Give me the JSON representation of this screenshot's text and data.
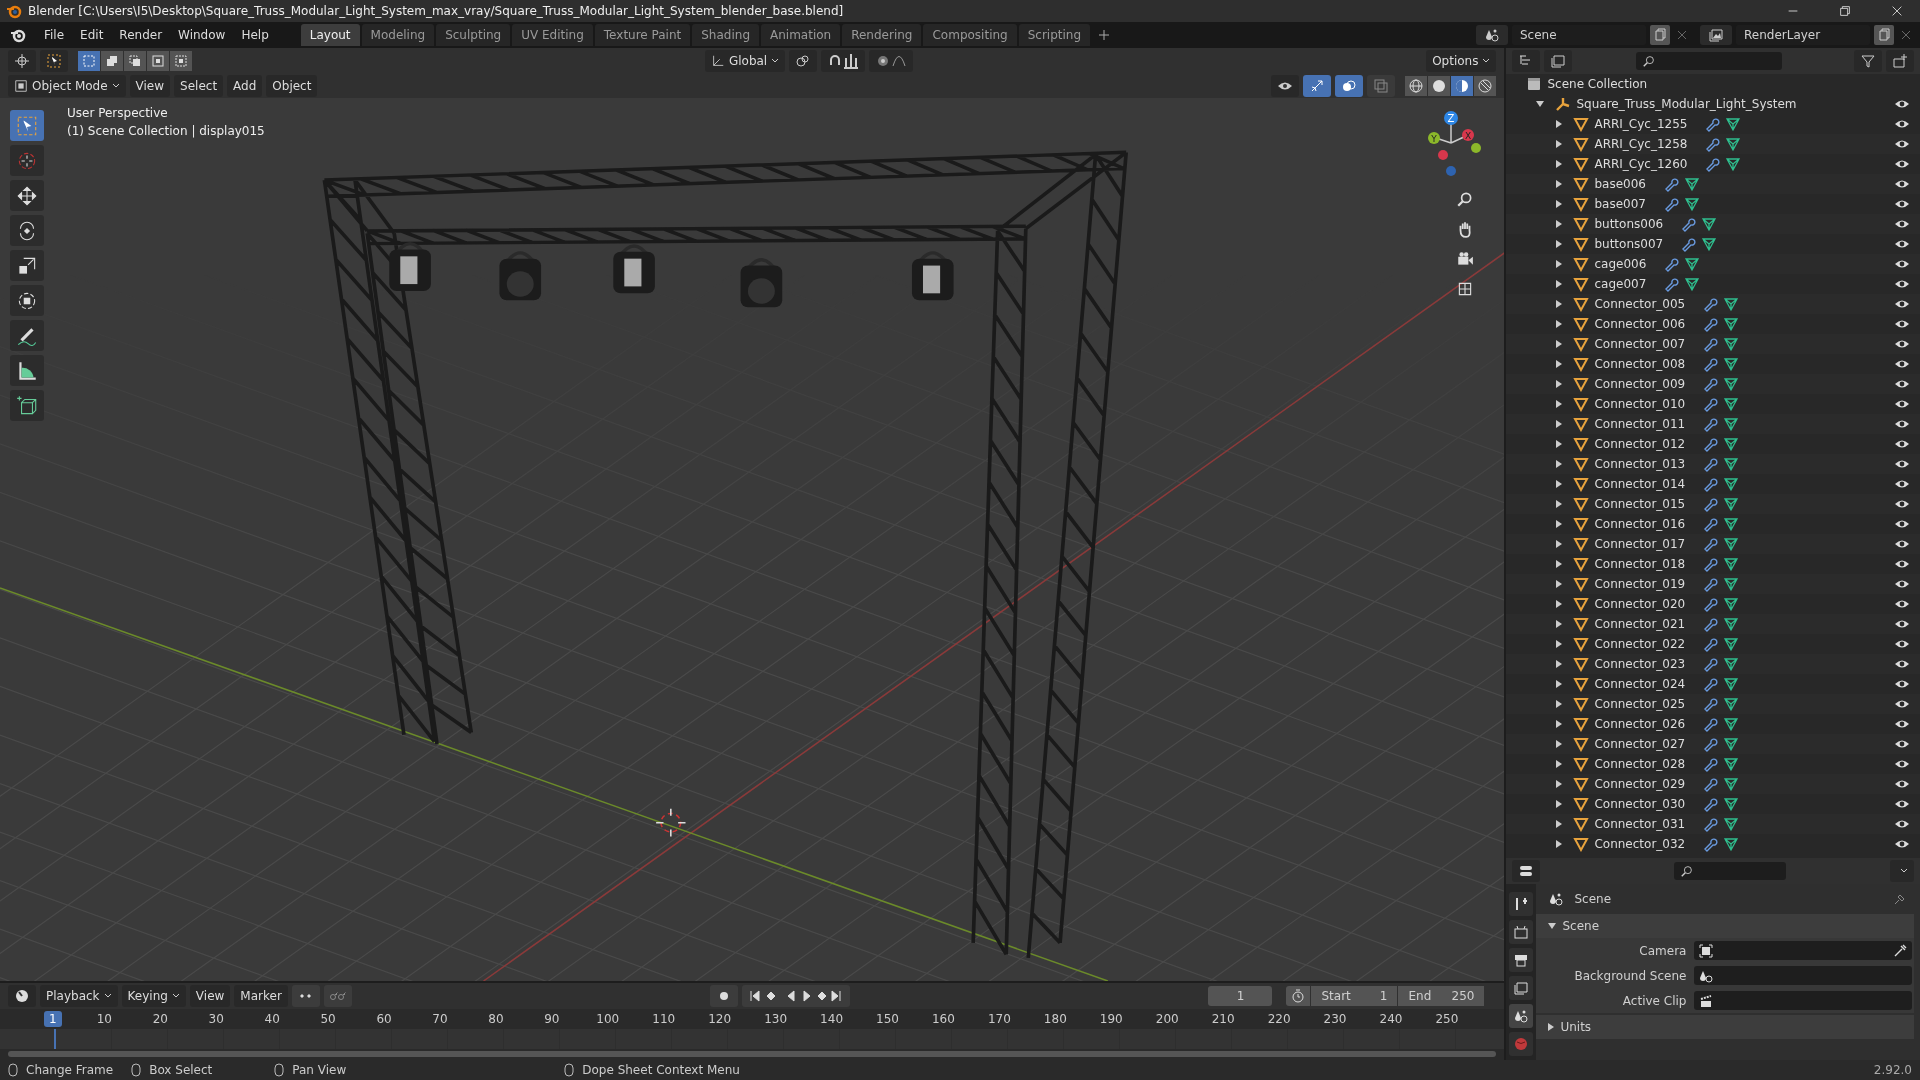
{
  "title_bar": {
    "title": "Blender [C:\\Users\\I5\\Desktop\\Square_Truss_Modular_Light_System_max_vray/Square_Truss_Modular_Light_System_blender_base.blend]"
  },
  "menu": [
    "File",
    "Edit",
    "Render",
    "Window",
    "Help"
  ],
  "workspace_tabs": [
    {
      "label": "Layout",
      "selected": true
    },
    {
      "label": "Modeling",
      "selected": false
    },
    {
      "label": "Sculpting",
      "selected": false
    },
    {
      "label": "UV Editing",
      "selected": false
    },
    {
      "label": "Texture Paint",
      "selected": false
    },
    {
      "label": "Shading",
      "selected": false
    },
    {
      "label": "Animation",
      "selected": false
    },
    {
      "label": "Rendering",
      "selected": false
    },
    {
      "label": "Compositing",
      "selected": false
    },
    {
      "label": "Scripting",
      "selected": false
    }
  ],
  "scene_selector": {
    "scene": "Scene",
    "view_layer": "RenderLayer"
  },
  "viewport": {
    "select_modes": [
      {
        "kind": "new",
        "selected": true
      },
      {
        "kind": "extend",
        "selected": false
      },
      {
        "kind": "subtract",
        "selected": false
      },
      {
        "kind": "invert",
        "selected": false
      },
      {
        "kind": "intersect",
        "selected": false
      }
    ],
    "orientation": "Global",
    "options": "Options",
    "mode": "Object Mode",
    "menus": [
      "View",
      "Select",
      "Add",
      "Object"
    ],
    "overlay_toggles": [
      {
        "kind": "gizmo",
        "on": true
      },
      {
        "kind": "overlay",
        "on": true
      },
      {
        "kind": "xray",
        "on": false
      }
    ],
    "shading_modes": [
      {
        "kind": "wireframe",
        "selected": false
      },
      {
        "kind": "solid",
        "selected": false
      },
      {
        "kind": "material",
        "selected": true
      },
      {
        "kind": "rendered",
        "selected": false
      }
    ],
    "view_name": "User Perspective",
    "context": "(1) Scene Collection | display015",
    "tools": [
      {
        "kind": "select",
        "selected": true
      },
      {
        "kind": "cursor",
        "selected": false
      },
      {
        "kind": "move",
        "selected": false
      },
      {
        "kind": "rotate",
        "selected": false
      },
      {
        "kind": "scale",
        "selected": false
      },
      {
        "kind": "transform",
        "selected": false
      },
      {
        "kind": "annotate",
        "selected": false
      },
      {
        "kind": "measure",
        "selected": false
      },
      {
        "kind": "add-cube",
        "selected": false
      }
    ],
    "gizmo_axes": [
      "Z",
      "Y",
      "X"
    ]
  },
  "outliner": {
    "root": "Scene Collection",
    "collection": {
      "name": "Square_Truss_Modular_Light_System",
      "expanded": true,
      "children": [
        {
          "name": "ARRI_Cyc_1255",
          "expanded": false
        },
        {
          "name": "ARRI_Cyc_1258",
          "expanded": false
        },
        {
          "name": "ARRI_Cyc_1260",
          "expanded": false
        },
        {
          "name": "base006",
          "expanded": false
        },
        {
          "name": "base007",
          "expanded": false
        },
        {
          "name": "buttons006",
          "expanded": false
        },
        {
          "name": "buttons007",
          "expanded": false
        },
        {
          "name": "cage006",
          "expanded": false
        },
        {
          "name": "cage007",
          "expanded": false
        },
        {
          "name": "Connector_005",
          "expanded": false
        },
        {
          "name": "Connector_006",
          "expanded": false
        },
        {
          "name": "Connector_007",
          "expanded": false
        },
        {
          "name": "Connector_008",
          "expanded": false
        },
        {
          "name": "Connector_009",
          "expanded": false
        },
        {
          "name": "Connector_010",
          "expanded": false
        },
        {
          "name": "Connector_011",
          "expanded": false
        },
        {
          "name": "Connector_012",
          "expanded": false
        },
        {
          "name": "Connector_013",
          "expanded": false
        },
        {
          "name": "Connector_014",
          "expanded": false
        },
        {
          "name": "Connector_015",
          "expanded": false
        },
        {
          "name": "Connector_016",
          "expanded": false
        },
        {
          "name": "Connector_017",
          "expanded": false
        },
        {
          "name": "Connector_018",
          "expanded": false
        },
        {
          "name": "Connector_019",
          "expanded": false
        },
        {
          "name": "Connector_020",
          "expanded": false
        },
        {
          "name": "Connector_021",
          "expanded": false
        },
        {
          "name": "Connector_022",
          "expanded": false
        },
        {
          "name": "Connector_023",
          "expanded": false
        },
        {
          "name": "Connector_024",
          "expanded": false
        },
        {
          "name": "Connector_025",
          "expanded": false
        },
        {
          "name": "Connector_026",
          "expanded": false
        },
        {
          "name": "Connector_027",
          "expanded": false
        },
        {
          "name": "Connector_028",
          "expanded": false
        },
        {
          "name": "Connector_029",
          "expanded": false
        },
        {
          "name": "Connector_030",
          "expanded": false
        },
        {
          "name": "Connector_031",
          "expanded": false
        },
        {
          "name": "Connector_032",
          "expanded": false
        }
      ]
    }
  },
  "properties": {
    "tabs": [
      {
        "kind": "tool",
        "selected": false
      },
      {
        "kind": "render",
        "selected": false
      },
      {
        "kind": "output",
        "selected": false
      },
      {
        "kind": "view-layer",
        "selected": false
      },
      {
        "kind": "scene",
        "selected": true
      },
      {
        "kind": "world",
        "selected": false
      }
    ],
    "header": "Scene",
    "panels": [
      {
        "title": "Scene",
        "expanded": true,
        "fields": [
          {
            "label": "Camera",
            "kind": "camera"
          },
          {
            "label": "Background Scene",
            "kind": "scene"
          },
          {
            "label": "Active Clip",
            "kind": "clip"
          }
        ]
      },
      {
        "title": "Units",
        "expanded": false
      }
    ]
  },
  "timeline": {
    "menus": [
      "Playback",
      "Keying"
    ],
    "plain_menus": [
      "View",
      "Marker"
    ],
    "current_frame": "1",
    "start_label": "Start",
    "start": "1",
    "end_label": "End",
    "end": "250",
    "playhead": "1",
    "ruler": [
      "10",
      "20",
      "30",
      "40",
      "50",
      "60",
      "70",
      "80",
      "90",
      "100",
      "110",
      "120",
      "130",
      "140",
      "150",
      "160",
      "170",
      "180",
      "190",
      "200",
      "210",
      "220",
      "230",
      "240",
      "250"
    ]
  },
  "status_bar": {
    "hints": [
      "Change Frame",
      "Box Select",
      "Pan View",
      "Dope Sheet Context Menu"
    ],
    "version": "2.92.0"
  }
}
